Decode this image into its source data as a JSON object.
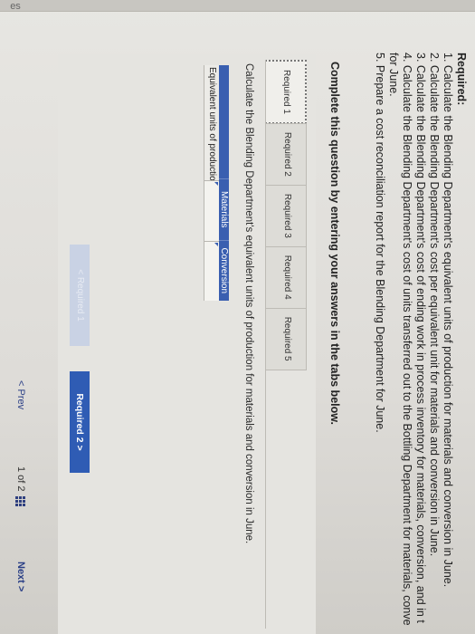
{
  "edge_label": "es",
  "required": {
    "title": "Required:",
    "items": [
      "1. Calculate the Blending Department's equivalent units of production for materials and conversion in June.",
      "2. Calculate the Blending Department's cost per equivalent unit for materials and conversion in June.",
      "3. Calculate the Blending Department's cost of ending work in process inventory for materials, conversion, and in t",
      "4. Calculate the Blending Department's cost of units transferred out to the Bottling Department for materials, conve",
      "for June.",
      "5. Prepare a cost reconciliation report for the Blending Department for June."
    ]
  },
  "instruction": "Complete this question by entering your answers in the tabs below.",
  "tabs": [
    "Required 1",
    "Required 2",
    "Required 3",
    "Required 4",
    "Required 5"
  ],
  "active_tab": 0,
  "question": "Calculate the Blending Department's equivalent units of production for materials and conversion in June.",
  "table": {
    "headers": [
      "Materials",
      "Conversion"
    ],
    "row_label": "Equivalent units of production",
    "values": [
      "",
      ""
    ]
  },
  "buttons": {
    "prev_tab": "< Required 1",
    "next_tab": "Required 2  >"
  },
  "pager": {
    "prev": "< Prev",
    "page": "1 of 2",
    "next": "Next >"
  },
  "colors": {
    "accent": "#2f5cb4",
    "header": "#3a5fb0"
  }
}
